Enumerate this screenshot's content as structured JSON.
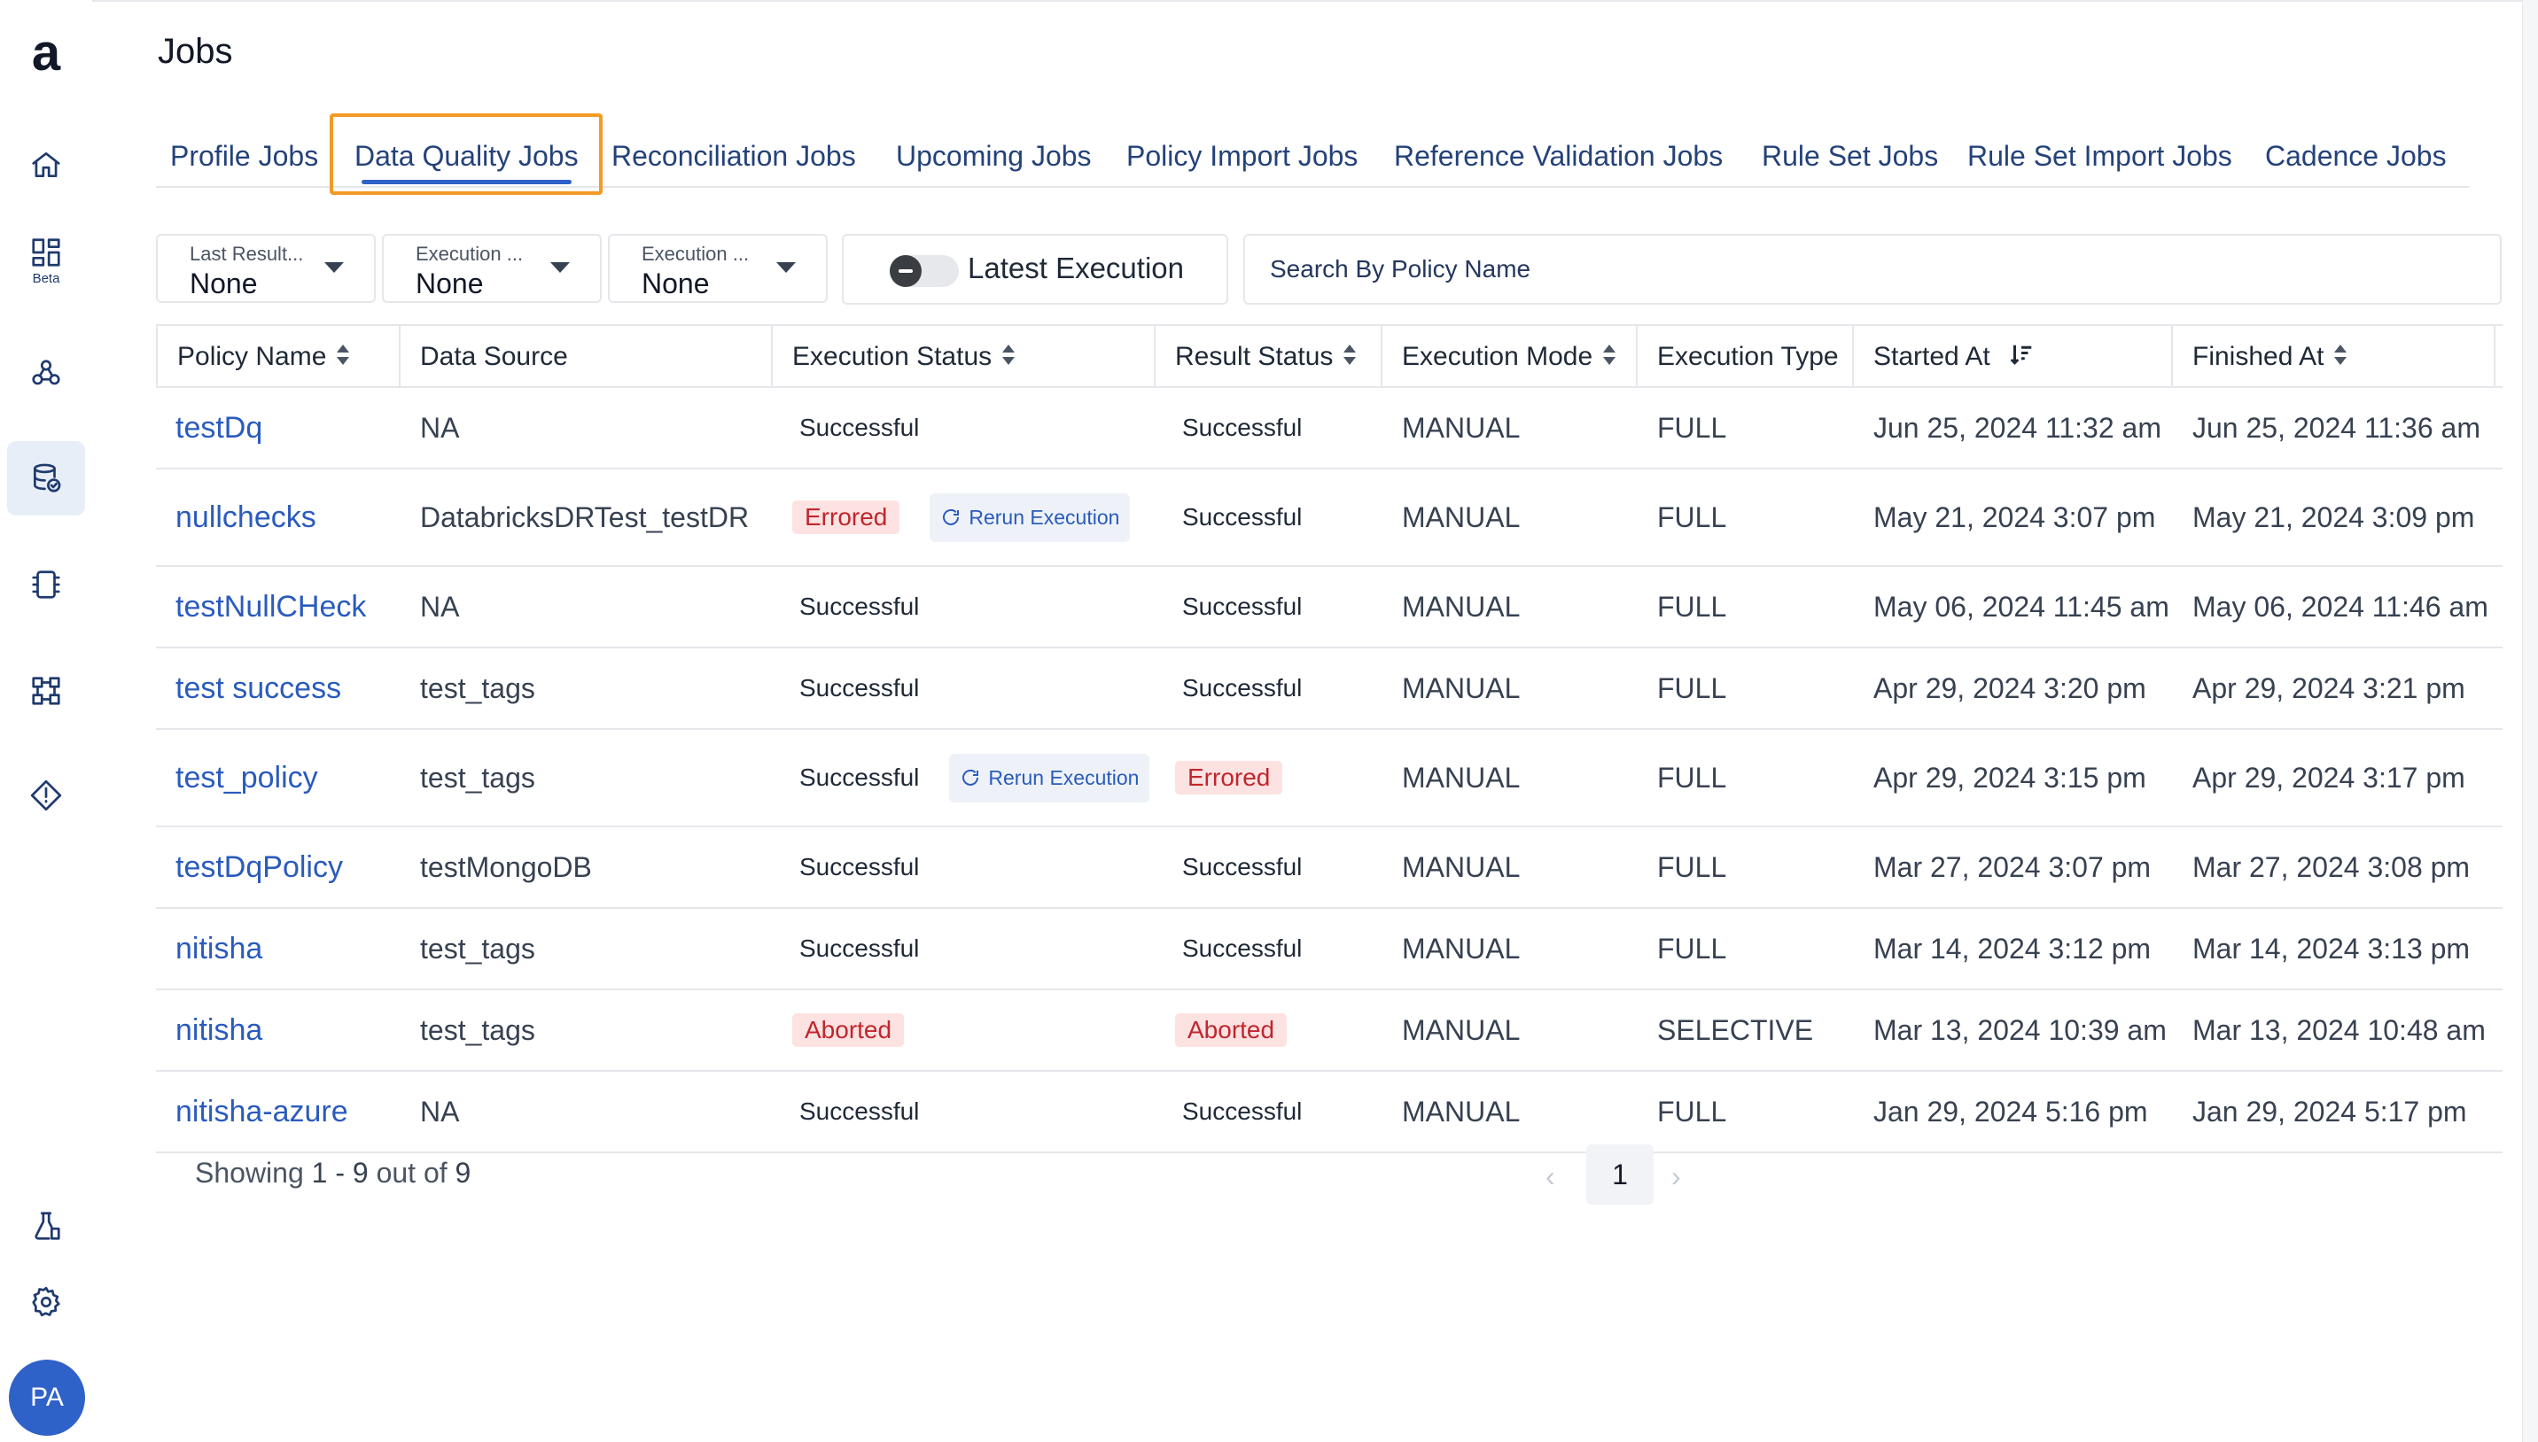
{
  "app": {
    "logo_letter": "a",
    "page_title": "Jobs"
  },
  "sidebar": {
    "items": [
      {
        "icon": "home-icon"
      },
      {
        "icon": "dashboard-icon",
        "badge": "Beta"
      },
      {
        "icon": "data-reliability-icon"
      },
      {
        "icon": "database-check-icon",
        "active": true
      },
      {
        "icon": "compute-icon"
      },
      {
        "icon": "pipeline-icon"
      },
      {
        "icon": "alert-icon"
      },
      {
        "icon": "lab-icon"
      },
      {
        "icon": "gear-icon"
      }
    ],
    "avatar_initials": "PA"
  },
  "tabs": [
    "Profile Jobs",
    "Data Quality Jobs",
    "Reconciliation Jobs",
    "Upcoming Jobs",
    "Policy Import Jobs",
    "Reference Validation Jobs",
    "Rule Set Jobs",
    "Rule Set Import Jobs",
    "Cadence Jobs"
  ],
  "selected_tab": "Data Quality Jobs",
  "filters": [
    {
      "label": "Last Result...",
      "value": "None"
    },
    {
      "label": "Execution ...",
      "value": "None"
    },
    {
      "label": "Execution ...",
      "value": "None"
    }
  ],
  "toggle": {
    "label": "Latest Execution",
    "on": false
  },
  "search": {
    "placeholder": "Search By Policy Name"
  },
  "table": {
    "columns": [
      "Policy Name",
      "Data Source",
      "Execution Status",
      "Result Status",
      "Execution Mode",
      "Execution Type",
      "Started At",
      "Finished At"
    ],
    "rerun_label": "Rerun Execution",
    "rows": [
      {
        "policy": "testDq",
        "source": "NA",
        "exec_status": "Successful",
        "rerun": false,
        "result": "Successful",
        "mode": "MANUAL",
        "type": "FULL",
        "started": "Jun 25, 2024 11:32 am",
        "finished": "Jun 25, 2024 11:36 am"
      },
      {
        "policy": "nullchecks",
        "source": "DatabricksDRTest_testDR",
        "exec_status": "Errored",
        "rerun": true,
        "result": "Successful",
        "mode": "MANUAL",
        "type": "FULL",
        "started": "May 21, 2024 3:07 pm",
        "finished": "May 21, 2024 3:09 pm"
      },
      {
        "policy": "testNullCHeck",
        "source": "NA",
        "exec_status": "Successful",
        "rerun": false,
        "result": "Successful",
        "mode": "MANUAL",
        "type": "FULL",
        "started": "May 06, 2024 11:45 am",
        "finished": "May 06, 2024 11:46 am"
      },
      {
        "policy": "test success",
        "source": "test_tags",
        "exec_status": "Successful",
        "rerun": false,
        "result": "Successful",
        "mode": "MANUAL",
        "type": "FULL",
        "started": "Apr 29, 2024 3:20 pm",
        "finished": "Apr 29, 2024 3:21 pm"
      },
      {
        "policy": "test_policy",
        "source": "test_tags",
        "exec_status": "Successful",
        "rerun": true,
        "result": "Errored",
        "mode": "MANUAL",
        "type": "FULL",
        "started": "Apr 29, 2024 3:15 pm",
        "finished": "Apr 29, 2024 3:17 pm"
      },
      {
        "policy": "testDqPolicy",
        "source": "testMongoDB",
        "exec_status": "Successful",
        "rerun": false,
        "result": "Successful",
        "mode": "MANUAL",
        "type": "FULL",
        "started": "Mar 27, 2024 3:07 pm",
        "finished": "Mar 27, 2024 3:08 pm"
      },
      {
        "policy": "nitisha",
        "source": "test_tags",
        "exec_status": "Successful",
        "rerun": false,
        "result": "Successful",
        "mode": "MANUAL",
        "type": "FULL",
        "started": "Mar 14, 2024 3:12 pm",
        "finished": "Mar 14, 2024 3:13 pm"
      },
      {
        "policy": "nitisha",
        "source": "test_tags",
        "exec_status": "Aborted",
        "rerun": false,
        "result": "Aborted",
        "mode": "MANUAL",
        "type": "SELECTIVE",
        "started": "Mar 13, 2024 10:39 am",
        "finished": "Mar 13, 2024 10:48 am"
      },
      {
        "policy": "nitisha-azure",
        "source": "NA",
        "exec_status": "Successful",
        "rerun": false,
        "result": "Successful",
        "mode": "MANUAL",
        "type": "FULL",
        "started": "Jan 29, 2024 5:16 pm",
        "finished": "Jan 29, 2024 5:17 pm"
      }
    ]
  },
  "footer": {
    "showing_prefix": "Showing",
    "range": "1 - 9",
    "out_of": "out of",
    "total": "9",
    "current_page": "1",
    "prev": "‹",
    "next": "›"
  },
  "colors": {
    "accent": "#2f62c8",
    "link": "#2a5bbd",
    "tab_text": "#24427a",
    "highlight": "#f39a24",
    "error_bg": "#fde2e2",
    "error_text": "#c0262d"
  }
}
